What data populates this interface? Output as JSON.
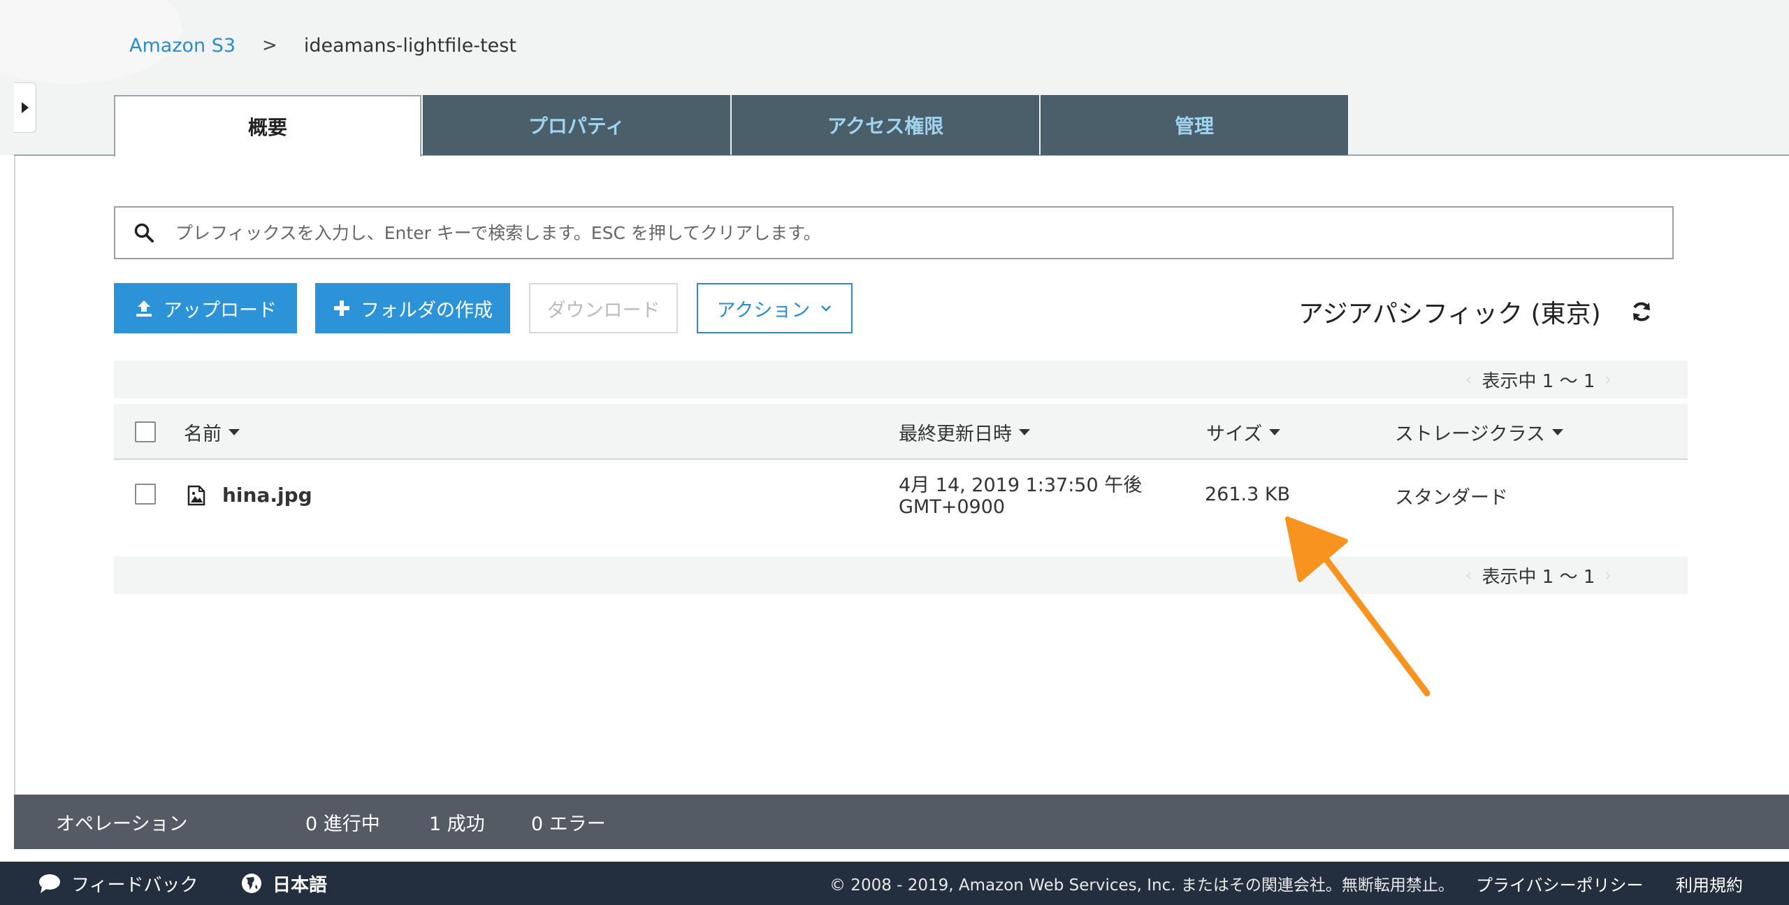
{
  "breadcrumb": {
    "root": "Amazon S3",
    "separator": ">",
    "bucket": "ideamans-lightfile-test"
  },
  "tabs": [
    {
      "label": "概要",
      "active": true
    },
    {
      "label": "プロパティ",
      "active": false
    },
    {
      "label": "アクセス権限",
      "active": false
    },
    {
      "label": "管理",
      "active": false
    }
  ],
  "search": {
    "placeholder": "プレフィックスを入力し、Enter キーで検索します。ESC を押してクリアします。",
    "value": ""
  },
  "toolbar": {
    "upload_label": "アップロード",
    "create_folder_label": "フォルダの作成",
    "download_label": "ダウンロード",
    "actions_label": "アクション"
  },
  "region": "アジアパシフィック (東京)",
  "pager": {
    "text": "表示中 1 ～ 1",
    "prev": "‹",
    "next": "›"
  },
  "table": {
    "columns": {
      "name": "名前",
      "modified": "最終更新日時",
      "size": "サイズ",
      "storage_class": "ストレージクラス"
    },
    "rows": [
      {
        "name": "hina.jpg",
        "modified_line1": "4月 14, 2019 1:37:50 午後",
        "modified_line2": "GMT+0900",
        "size": "261.3 KB",
        "storage_class": "スタンダード"
      }
    ]
  },
  "operations": {
    "title": "オペレーション",
    "in_progress": "0 進行中",
    "success": "1 成功",
    "error": "0 エラー"
  },
  "footer": {
    "feedback": "フィードバック",
    "language": "日本語",
    "copyright": "© 2008 - 2019, Amazon Web Services, Inc. またはその関連会社。無断転用禁止。",
    "privacy": "プライバシーポリシー",
    "terms": "利用規約"
  },
  "colors": {
    "accent": "#2d93d8",
    "tab_bg": "#4b5f6b",
    "tab_text": "#9fd3f0",
    "ops_bar": "#545b64",
    "footer_bg": "#232f3e",
    "annotation": "#f7931e"
  }
}
